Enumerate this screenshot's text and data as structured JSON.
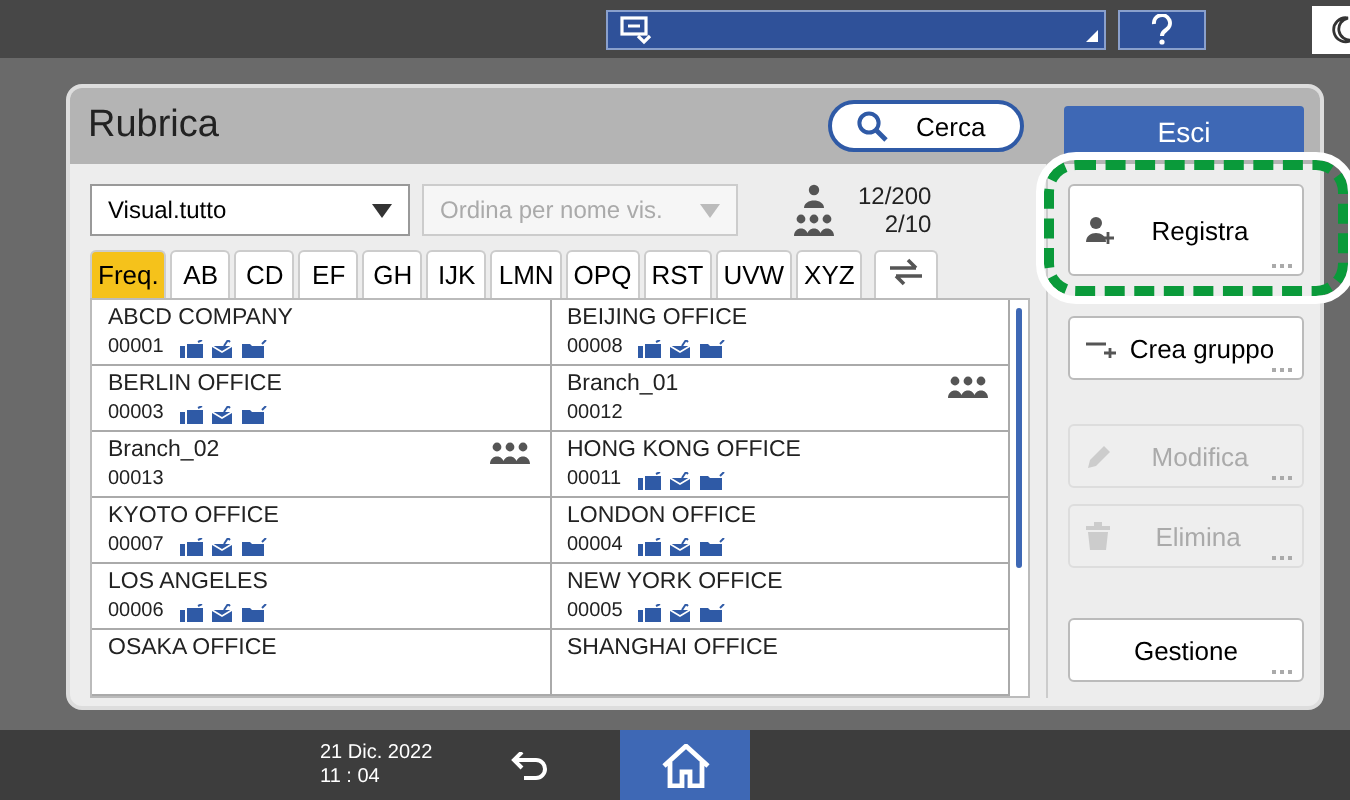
{
  "title": "Rubrica",
  "search_button": "Cerca",
  "exit_button": "Esci",
  "filter": {
    "value": "Visual.tutto"
  },
  "sort": {
    "value": "Ordina per nome vis.",
    "disabled": true
  },
  "counts": {
    "contacts": "12/200",
    "groups": "2/10"
  },
  "tabs": [
    {
      "label": "Freq.",
      "selected": true
    },
    {
      "label": "AB",
      "selected": false
    },
    {
      "label": "CD",
      "selected": false
    },
    {
      "label": "EF",
      "selected": false
    },
    {
      "label": "GH",
      "selected": false
    },
    {
      "label": "IJK",
      "selected": false
    },
    {
      "label": "LMN",
      "selected": false
    },
    {
      "label": "OPQ",
      "selected": false
    },
    {
      "label": "RST",
      "selected": false
    },
    {
      "label": "UVW",
      "selected": false
    },
    {
      "label": "XYZ",
      "selected": false
    }
  ],
  "entries": [
    {
      "name": "ABCD COMPANY",
      "number": "00001",
      "kind": "contact"
    },
    {
      "name": "BEIJING OFFICE",
      "number": "00008",
      "kind": "contact"
    },
    {
      "name": "BERLIN OFFICE",
      "number": "00003",
      "kind": "contact"
    },
    {
      "name": "Branch_01",
      "number": "00012",
      "kind": "group"
    },
    {
      "name": "Branch_02",
      "number": "00013",
      "kind": "group"
    },
    {
      "name": "HONG KONG OFFICE",
      "number": "00011",
      "kind": "contact"
    },
    {
      "name": "KYOTO OFFICE",
      "number": "00007",
      "kind": "contact"
    },
    {
      "name": "LONDON OFFICE",
      "number": "00004",
      "kind": "contact"
    },
    {
      "name": "LOS ANGELES",
      "number": "00006",
      "kind": "contact"
    },
    {
      "name": "NEW YORK OFFICE",
      "number": "00005",
      "kind": "contact"
    },
    {
      "name": "OSAKA OFFICE",
      "kind": "contact-partial"
    },
    {
      "name": "SHANGHAI OFFICE",
      "kind": "contact-partial"
    }
  ],
  "actions": [
    {
      "label": "Registra",
      "kind": "add-user",
      "disabled": false,
      "highlighted": true
    },
    {
      "label": "Crea gruppo",
      "kind": "add-group",
      "disabled": false,
      "highlighted": false
    },
    {
      "label": "Modifica",
      "kind": "edit",
      "disabled": true,
      "highlighted": false
    },
    {
      "label": "Elimina",
      "kind": "delete",
      "disabled": true,
      "highlighted": false
    },
    {
      "label": "Gestione",
      "kind": "plain",
      "disabled": false,
      "highlighted": false
    }
  ],
  "status_bar": {
    "date": "21 Dic. 2022",
    "time": "11 : 04"
  }
}
